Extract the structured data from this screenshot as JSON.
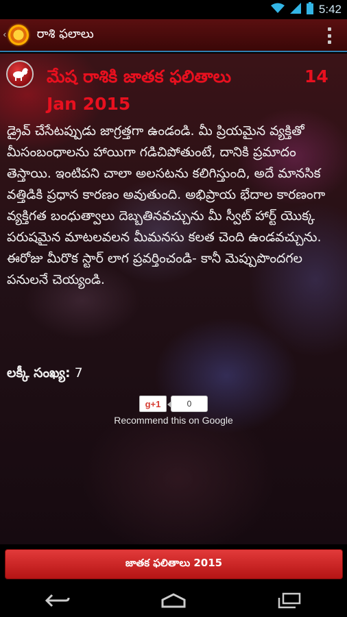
{
  "status_bar": {
    "time": "5:42",
    "icons": [
      "wifi-icon",
      "signal-icon",
      "battery-icon"
    ]
  },
  "action_bar": {
    "title": "రాశి ఫలాలు",
    "icons": [
      "app-logo-icon",
      "overflow-menu-icon"
    ]
  },
  "horoscope": {
    "sign_icon": "ram-icon",
    "title": "మేష రాశికి జాతక ఫలితాలు",
    "date_part1": "14",
    "date_part2": "Jan 2015",
    "prediction": "డ్రైవ్ చేసేటప్పుడు జాగ్రత్తగా ఉండండి. మీ ప్రియమైన వ్యక్తితో మీసంబంధాలను హాయిగా గడిచిపోతుంటే, దానికి ప్రమాదం తెస్తాయి. ఇంటిపని చాలా అలసటను కలిగిస్తుంది, అదే మానసిక వత్తిడికి ప్రధాన కారణం అవుతుంది. అభిప్రాయ భేదాల కారణంగా వ్యక్తిగత బంధుత్వాలు దెబ్బతినవచ్చును మీ స్వీట్ హార్ట్ యొక్క పరుషమైన మాటలవలన మీమనసు కలత చెంది ఉండవచ్చును. ఈరోజు మీరొక స్టార్ లాగ ప్రవర్తించండి- కానీ మెప్పుపొందగల పనులనే చెయ్యండి.",
    "lucky_label": "లక్కీ సంఖ్య:",
    "lucky_number": "7"
  },
  "google_plus": {
    "button_label": "g+1",
    "count": "0",
    "recommend_text": "Recommend this on Google"
  },
  "bottom_button": {
    "label": "జాతక ఫలితాలు 2015"
  },
  "nav_bar": {
    "icons": [
      "back-icon",
      "home-icon",
      "recent-apps-icon"
    ]
  },
  "colors": {
    "action_bar": "#4a0b0c",
    "accent_line": "#2f7fb2",
    "heading_red": "#e8101f",
    "button_red": "#d02828"
  }
}
